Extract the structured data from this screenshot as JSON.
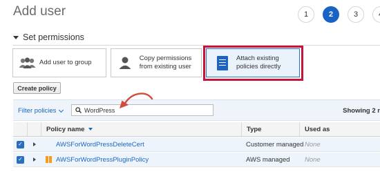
{
  "page": {
    "title": "Add user"
  },
  "stepper": {
    "steps": [
      "1",
      "2",
      "3",
      "4"
    ],
    "active": 2
  },
  "section": {
    "title": "Set permissions"
  },
  "options": {
    "add_to_group": "Add user to group",
    "copy_permissions": "Copy permissions from existing user",
    "attach_policies": "Attach existing policies directly"
  },
  "create_policy": "Create policy",
  "filter": {
    "label": "Filter policies",
    "search_value": "WordPress",
    "showing": "Showing 2 r"
  },
  "table": {
    "columns": [
      "Policy name",
      "Type",
      "Used as"
    ],
    "rows": [
      {
        "name": "AWSForWordPressDeleteCert",
        "type": "Customer managed",
        "used_as": "None",
        "checked": true
      },
      {
        "name": "AWSForWordPressPluginPolicy",
        "type": "AWS managed",
        "used_as": "None",
        "checked": true
      }
    ]
  },
  "colors": {
    "accent": "#1a63c6",
    "highlight": "#c8143c",
    "annotation_arrow": "#d24b3c",
    "aws_orange": "#f79a1e"
  }
}
